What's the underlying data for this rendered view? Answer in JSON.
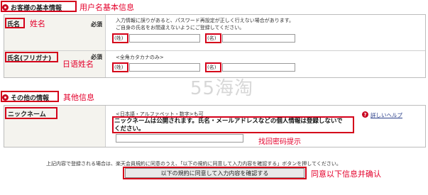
{
  "sections": {
    "basic": {
      "title": "お客様の基本情報",
      "annotation": "用户名基本信息"
    },
    "other": {
      "title": "その他の情報",
      "annotation": "其他信息"
    }
  },
  "name_row": {
    "label": "氏名",
    "annotation": "姓名",
    "required": "必須",
    "note_line1": "入力情報に誤りがあると、パスワード再設定が正しく行えない場合があります。",
    "note_line2": "ご自身の氏名をお間違えないようにご登録してください。",
    "last_label": "(姓)",
    "first_label": "(名)",
    "last_value": "",
    "first_value": ""
  },
  "kana_row": {
    "label": "氏名(フリガナ)",
    "annotation": "日语姓名",
    "required": "必須",
    "note": "<全角カタカナのみ>",
    "last_label": "(姓)",
    "first_label": "(名)",
    "last_value": "",
    "first_value": ""
  },
  "nickname_row": {
    "label": "ニックネーム",
    "hint": "<日本語・アルファベット・数字>も可",
    "warning_line1": "ニックネームは公開されます。氏名・メールアドレスなどの個人情報は登録しないで",
    "warning_line2": "ください。",
    "value": "",
    "annotation": "找回密码提示",
    "help_label": "詳しいヘルプ"
  },
  "watermark": "55海淘",
  "consent": {
    "text": "上記内容で登録される場合は、楽天会員規約に同意のうえ、「以下の規約に同意して入力内容を確認する」ボタンを押してください。",
    "button_label": "以下の規約に同意して入力内容を確認する",
    "annotation": "同意以下信息并确认"
  },
  "colors": {
    "accent": "#d4001a",
    "annotation": "#e4002b",
    "label_bg": "#f4f3ee"
  }
}
